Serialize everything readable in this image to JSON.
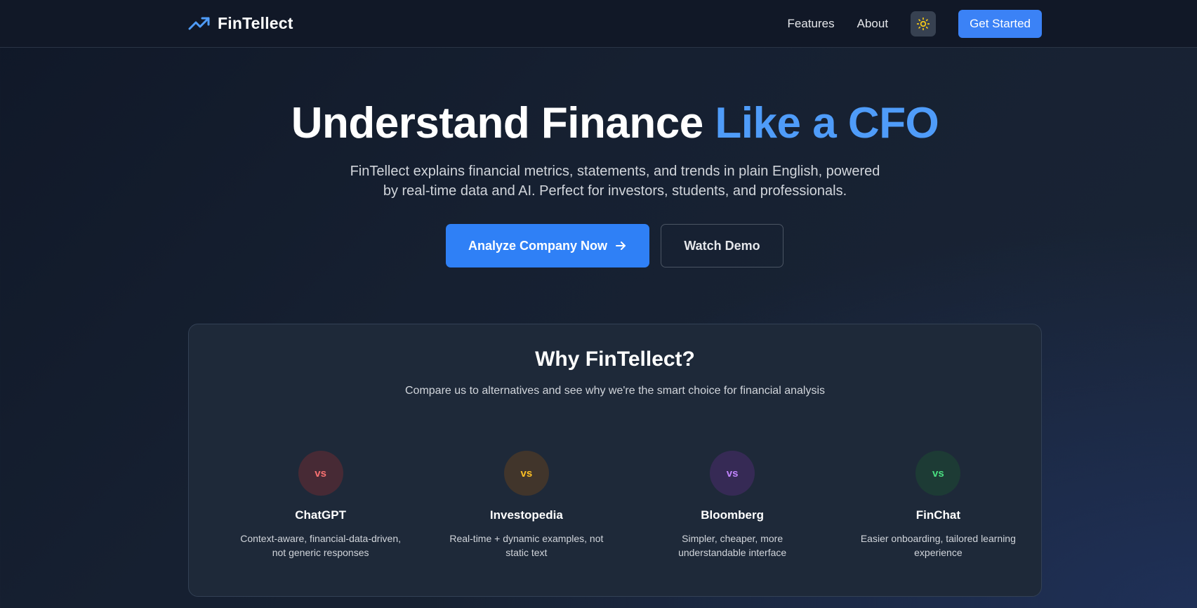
{
  "nav": {
    "brand": "FinTellect",
    "brand_icon": "trending-up-icon",
    "links": [
      "Features",
      "About"
    ],
    "theme_icon": "sun-icon",
    "cta": "Get Started"
  },
  "hero": {
    "title_main": "Understand Finance ",
    "title_accent": "Like a CFO",
    "subtitle_line1": "FinTellect explains financial metrics, statements, and trends in plain English, powered",
    "subtitle_line2": "by real-time data and AI. Perfect for investors, students, and professionals.",
    "primary_cta": "Analyze Company Now",
    "primary_icon": "arrow-right-icon",
    "secondary_cta": "Watch Demo"
  },
  "why": {
    "title": "Why FinTellect?",
    "subtitle": "Compare us to alternatives and see why we're the smart choice for financial analysis",
    "items": [
      {
        "badge": "vs",
        "name": "ChatGPT",
        "desc": "Context-aware, financial-data-driven, not generic responses",
        "color": "#f87171",
        "bg": "#472a35"
      },
      {
        "badge": "vs",
        "name": "Investopedia",
        "desc": "Real-time + dynamic examples, not static text",
        "color": "#fbbf24",
        "bg": "#41352b"
      },
      {
        "badge": "vs",
        "name": "Bloomberg",
        "desc": "Simpler, cheaper, more understandable interface",
        "color": "#c084fc",
        "bg": "#362a55"
      },
      {
        "badge": "vs",
        "name": "FinChat",
        "desc": "Easier onboarding, tailored learning experience",
        "color": "#4ade80",
        "bg": "#1d3b35"
      }
    ]
  },
  "colors": {
    "accent": "#3b82f6",
    "title_accent": "#4f9cf9",
    "nav_bg": "#111827"
  }
}
